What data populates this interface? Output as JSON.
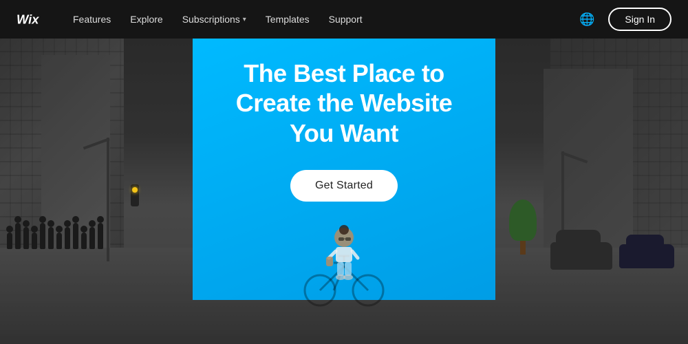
{
  "navbar": {
    "logo_text": "Wix",
    "links": [
      {
        "id": "features",
        "label": "Features",
        "has_dropdown": false
      },
      {
        "id": "explore",
        "label": "Explore",
        "has_dropdown": false
      },
      {
        "id": "subscriptions",
        "label": "Subscriptions",
        "has_dropdown": true
      },
      {
        "id": "templates",
        "label": "Templates",
        "has_dropdown": false
      },
      {
        "id": "support",
        "label": "Support",
        "has_dropdown": false
      }
    ],
    "globe_aria": "Language selector",
    "signin_label": "Sign In"
  },
  "hero": {
    "title_line1": "The Best Place to",
    "title_line2": "Create the Website You Want",
    "cta_label": "Get Started"
  },
  "colors": {
    "navbar_bg": "#141414",
    "hero_blue": "#00aaff",
    "cta_bg": "#ffffff",
    "cta_text": "#222222",
    "nav_text": "#dddddd",
    "signin_border": "#ffffff"
  }
}
